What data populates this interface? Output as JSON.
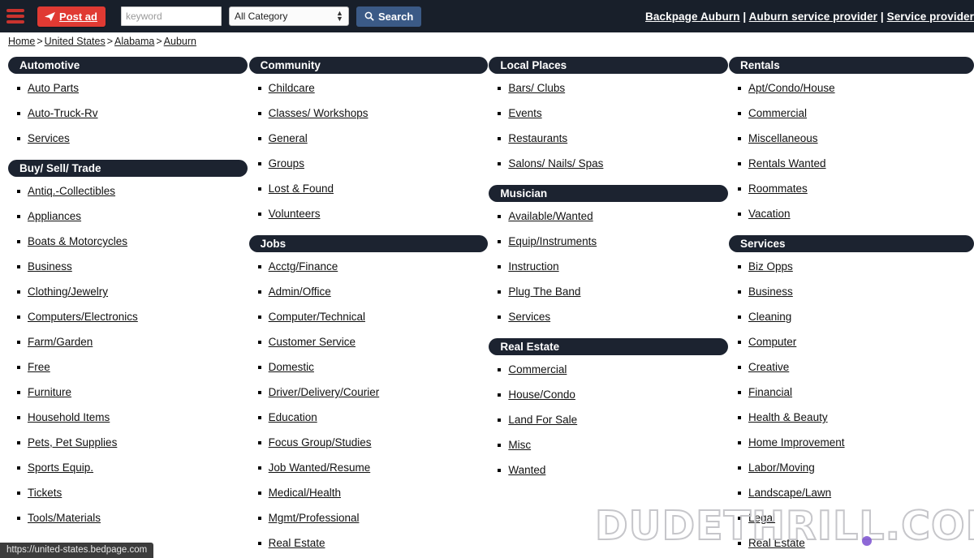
{
  "navbar": {
    "menu_icon": "hamburger-icon",
    "post_ad_label": "Post ad",
    "search_placeholder": "keyword",
    "search_value": "",
    "category_selected": "All Category",
    "category_options": [
      "All Category"
    ],
    "search_button_label": "Search",
    "right_links": [
      "Backpage Auburn",
      "Auburn service provider",
      "Service provider"
    ],
    "right_separator": " | "
  },
  "breadcrumb": {
    "separator": ">",
    "items": [
      "Home",
      "United States",
      "Alabama",
      "Auburn"
    ]
  },
  "columns": [
    {
      "sections": [
        {
          "title": "Automotive",
          "items": [
            "Auto Parts",
            "Auto-Truck-Rv",
            "Services"
          ]
        },
        {
          "title": "Buy/ Sell/ Trade",
          "items": [
            "Antiq.-Collectibles",
            "Appliances",
            "Boats & Motorcycles",
            "Business",
            "Clothing/Jewelry",
            "Computers/Electronics",
            "Farm/Garden",
            "Free",
            "Furniture",
            "Household Items",
            "Pets, Pet Supplies",
            "Sports Equip.",
            "Tickets",
            "Tools/Materials"
          ]
        }
      ]
    },
    {
      "sections": [
        {
          "title": "Community",
          "items": [
            "Childcare",
            "Classes/ Workshops",
            "General",
            "Groups",
            "Lost & Found",
            "Volunteers"
          ]
        },
        {
          "title": "Jobs",
          "items": [
            "Acctg/Finance",
            "Admin/Office",
            "Computer/Technical",
            "Customer Service",
            "Domestic",
            "Driver/Delivery/Courier",
            "Education",
            "Focus Group/Studies",
            "Job Wanted/Resume",
            "Medical/Health",
            "Mgmt/Professional",
            "Real Estate"
          ]
        }
      ]
    },
    {
      "sections": [
        {
          "title": "Local Places",
          "items": [
            "Bars/ Clubs",
            "Events",
            "Restaurants",
            "Salons/ Nails/ Spas"
          ]
        },
        {
          "title": "Musician",
          "items": [
            "Available/Wanted",
            "Equip/Instruments",
            "Instruction",
            "Plug The Band",
            "Services"
          ]
        },
        {
          "title": "Real Estate",
          "items": [
            "Commercial",
            "House/Condo",
            "Land For Sale",
            "Misc",
            "Wanted"
          ]
        }
      ]
    },
    {
      "sections": [
        {
          "title": "Rentals",
          "items": [
            "Apt/Condo/House",
            "Commercial",
            "Miscellaneous",
            "Rentals Wanted",
            "Roommates",
            "Vacation"
          ]
        },
        {
          "title": "Services",
          "items": [
            "Biz Opps",
            "Business",
            "Cleaning",
            "Computer",
            "Creative",
            "Financial",
            "Health & Beauty",
            "Home Improvement",
            "Labor/Moving",
            "Landscape/Lawn",
            "Legal",
            "Real Estate"
          ]
        }
      ]
    }
  ],
  "watermark": {
    "text": "DUDETHRILL.COM"
  },
  "statusbar": {
    "url": "https://united-states.bedpage.com"
  },
  "colors": {
    "navbar_bg": "#181f2a",
    "post_ad_red": "#e03a33",
    "hamburger_red": "#c9332e",
    "search_blue": "#3b5a86",
    "section_header_bg": "#1c2330",
    "link_text": "#111111",
    "statusbar_bg": "#3c3c3c",
    "watermark_stroke": "#c4c4c8",
    "cursor_dot": "#7a4fd0"
  }
}
